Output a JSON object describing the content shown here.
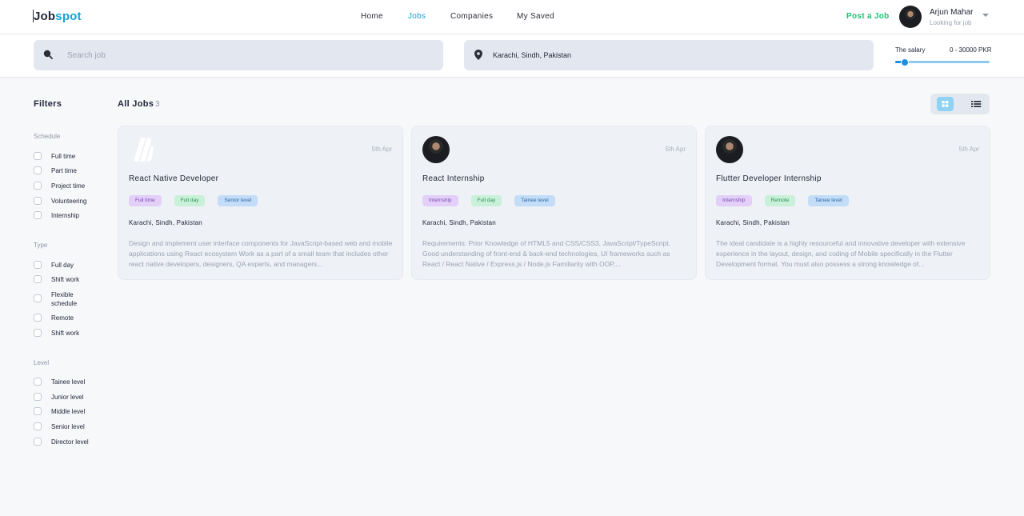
{
  "brand": {
    "part1": "Job",
    "part2": "spot"
  },
  "nav": {
    "items": [
      "Home",
      "Jobs",
      "Companies",
      "My Saved"
    ],
    "active": "Jobs"
  },
  "header": {
    "post_job_label": "Post a Job",
    "user_name": "Arjun Mahar",
    "user_status": "Looking for job"
  },
  "search": {
    "placeholder": "Search job",
    "location_value": "Karachi, Sindh, Pakistan"
  },
  "salary": {
    "label": "The salary",
    "range_text": "0 - 30000 PKR",
    "slider_position": 0.1
  },
  "filters": {
    "title": "Filters",
    "groups": [
      {
        "title": "Schedule",
        "options": [
          "Full time",
          "Part time",
          "Project time",
          "Volunteering",
          "Internship"
        ]
      },
      {
        "title": "Type",
        "options": [
          "Full day",
          "Shift work",
          "Flexible schedule",
          "Remote",
          "Shift work"
        ]
      },
      {
        "title": "Level",
        "options": [
          "Tainee level",
          "Junior level",
          "Middle level",
          "Senior level",
          "Director level"
        ]
      }
    ]
  },
  "main": {
    "title": "All Jobs",
    "count": "3"
  },
  "jobs": [
    {
      "title": "React Native Developer",
      "date": "5th Apr",
      "logo": "logo-icon",
      "tags": [
        {
          "label": "Full time",
          "color": "#e3cff8"
        },
        {
          "label": "Full day",
          "color": "#c9f0d9"
        },
        {
          "label": "Senior level",
          "color": "#c3dcf7"
        }
      ],
      "location": "Karachi, Sindh, Pakistan",
      "description": "Design and implement user interface components for JavaScript-based web and mobile applications using React ecosystem Work as a part of a small team that includes other react native developers, designers, QA experts, and managers..."
    },
    {
      "title": "React Internship",
      "date": "5th Apr",
      "logo": "photo",
      "tags": [
        {
          "label": "Internship",
          "color": "#e3cff8"
        },
        {
          "label": "Full day",
          "color": "#c9f0d9"
        },
        {
          "label": "Tainee level",
          "color": "#c3dcf7"
        }
      ],
      "location": "Karachi, Sindh, Pakistan",
      "description": "Requirements: Prior Knowledge of HTML5 and CSS/CSS3, JavaScript/TypeScript. Good understanding of front-end & back-end technologies, UI frameworks such as React / React Native / Express.js / Node.js Familiarity with OOP,..."
    },
    {
      "title": "Flutter Developer Internship",
      "date": "5th Apr",
      "logo": "photo",
      "tags": [
        {
          "label": "Internship",
          "color": "#e3cff8"
        },
        {
          "label": "Remote",
          "color": "#c9f0d9"
        },
        {
          "label": "Tainee level",
          "color": "#c3dcf7"
        }
      ],
      "location": "Karachi, Sindh, Pakistan",
      "description": "The ideal candidate is a highly resourceful and innovative developer with extensive experience in the layout, design, and coding of Mobile specifically in the Flutter Development format. You must also possess a strong knowledge of..."
    }
  ]
}
